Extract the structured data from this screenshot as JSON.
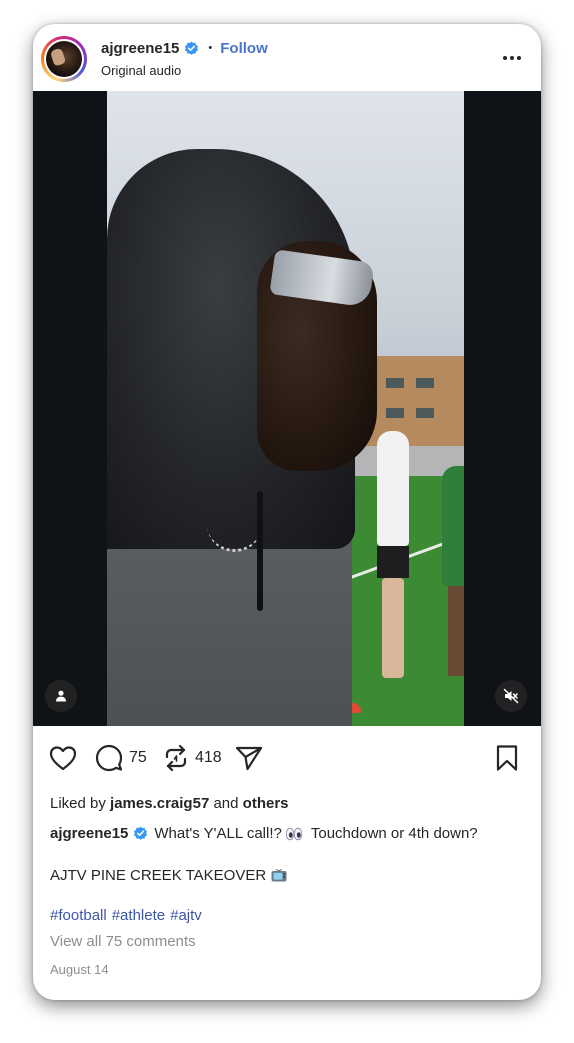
{
  "post": {
    "username": "ajgreene15",
    "separator": "•",
    "follow_label": "Follow",
    "audio": "Original audio"
  },
  "actions": {
    "comment_count": "75",
    "repost_count": "418"
  },
  "likes": {
    "prefix": "Liked by",
    "user": "james.craig57",
    "connector": "and",
    "others": "others"
  },
  "caption": {
    "username": "ajgreene15",
    "text": "What's Y'ALL call!?",
    "text2": "Touchdown or 4th down?",
    "line2": "AJTV PINE CREEK TAKEOVER"
  },
  "hashtags": [
    "#football",
    "#athlete",
    "#ajtv"
  ],
  "view_comments": "View all 75 comments",
  "date": "August 14",
  "colors": {
    "follow": "#4a74c9",
    "verified": "#3897f0",
    "hashtag": "#3e57a7",
    "muted_text": "#8e8e8e"
  },
  "icons": [
    "verified-badge-icon",
    "more-options-icon",
    "user-tag-icon",
    "muted-volume-icon",
    "heart-icon",
    "comment-icon",
    "repost-icon",
    "share-icon",
    "bookmark-icon",
    "eyes-emoji-icon",
    "tv-emoji-icon"
  ]
}
